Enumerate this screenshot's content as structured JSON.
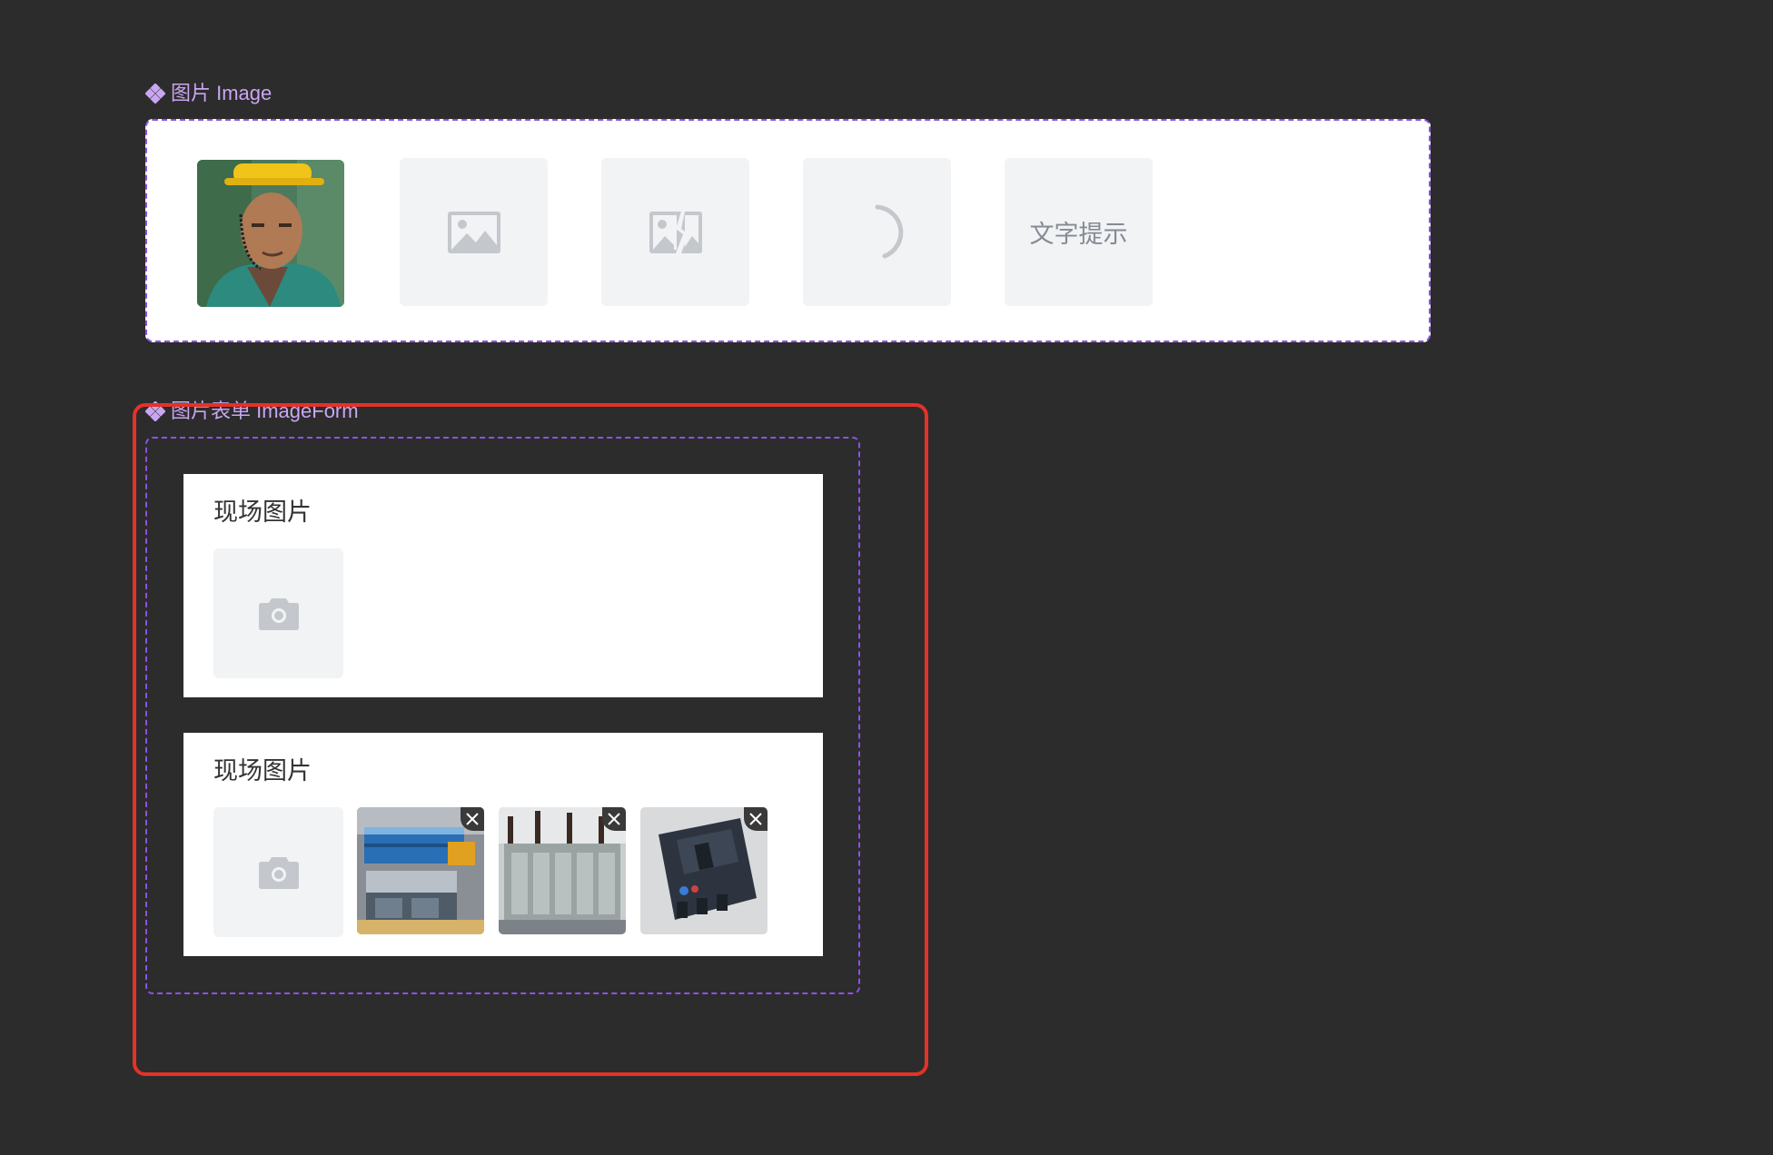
{
  "image_section": {
    "label": "图片 Image",
    "items": [
      {
        "type": "photo",
        "icon": "worker-photo"
      },
      {
        "type": "placeholder",
        "icon": "image-icon"
      },
      {
        "type": "error",
        "icon": "broken-image-icon"
      },
      {
        "type": "loading",
        "icon": "loading-spinner-icon"
      },
      {
        "type": "text",
        "text": "文字提示"
      }
    ]
  },
  "form_section": {
    "label": "图片表单 ImageForm",
    "cards": [
      {
        "title": "现场图片",
        "upload_icon": "camera-icon",
        "images": []
      },
      {
        "title": "现场图片",
        "upload_icon": "camera-icon",
        "images": [
          {
            "icon": "equipment-photo-1"
          },
          {
            "icon": "transformer-photo"
          },
          {
            "icon": "circuit-breaker-photo"
          }
        ]
      }
    ]
  },
  "colors": {
    "background": "#2c2c2c",
    "accent_dashed": "#8e51e6",
    "label": "#c9a6f2",
    "highlight": "#e53227",
    "placeholder_bg": "#f1f3f5",
    "placeholder_icon": "#c4c8cd"
  }
}
